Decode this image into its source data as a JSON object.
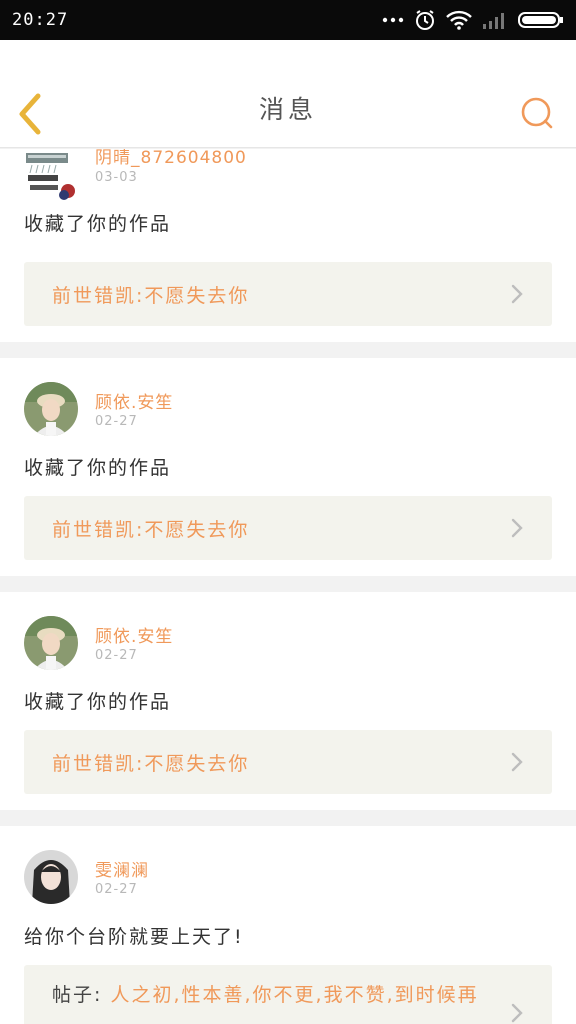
{
  "status_bar": {
    "time": "20:27"
  },
  "header": {
    "title": "消息"
  },
  "colors": {
    "accent": "#f0995a",
    "back_arrow": "#e8b43a"
  },
  "messages": [
    {
      "user": "阴晴_872604800",
      "date": "03-03",
      "action": "收藏了你的作品",
      "work": "前世错凯:不愿失去你"
    },
    {
      "user": "顾依.安笙",
      "date": "02-27",
      "action": "收藏了你的作品",
      "work": "前世错凯:不愿失去你"
    },
    {
      "user": "顾依.安笙",
      "date": "02-27",
      "action": "收藏了你的作品",
      "work": "前世错凯:不愿失去你"
    },
    {
      "user": "雯澜澜",
      "date": "02-27",
      "action": "给你个台阶就要上天了!",
      "post_label": "帖子:",
      "work": "人之初,性本善,你不更,我不赞,到时候再"
    }
  ]
}
